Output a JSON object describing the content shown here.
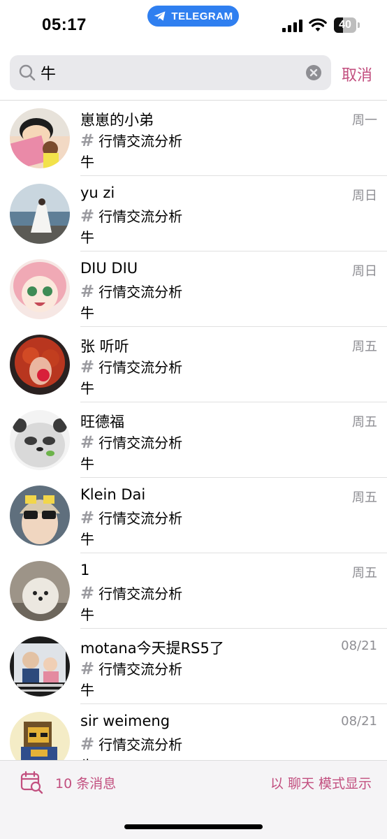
{
  "status_bar": {
    "time": "05:17",
    "pill_label": "TELEGRAM",
    "battery_level": "40",
    "battery_fraction": 0.4
  },
  "search": {
    "query": "牛",
    "cancel_label": "取消"
  },
  "results": [
    {
      "name": "崽崽的小弟",
      "date": "周一",
      "group": "行情交流分析",
      "message": "牛"
    },
    {
      "name": "yu zi",
      "date": "周日",
      "group": "行情交流分析",
      "message": "牛"
    },
    {
      "name": "DIU DIU",
      "date": "周日",
      "group": "行情交流分析",
      "message": "牛"
    },
    {
      "name": "张 听听",
      "date": "周五",
      "group": "行情交流分析",
      "message": "牛"
    },
    {
      "name": "旺德福",
      "date": "周五",
      "group": "行情交流分析",
      "message": "牛"
    },
    {
      "name": "Klein Dai",
      "date": "周五",
      "group": "行情交流分析",
      "message": "牛"
    },
    {
      "name": "1",
      "date": "周五",
      "group": "行情交流分析",
      "message": "牛"
    },
    {
      "name": "motana今天提RS5了",
      "date": "08/21",
      "group": "行情交流分析",
      "message": "牛"
    },
    {
      "name": "sir weimeng",
      "date": "08/21",
      "group": "行情交流分析",
      "message": "牛"
    }
  ],
  "bottom": {
    "count_label": "10 条消息",
    "mode_label": "以 聊天 模式显示"
  },
  "colors": {
    "accent": "#c24f7f",
    "pill": "#2f7ff0",
    "secondary_text": "#8e8e93"
  }
}
